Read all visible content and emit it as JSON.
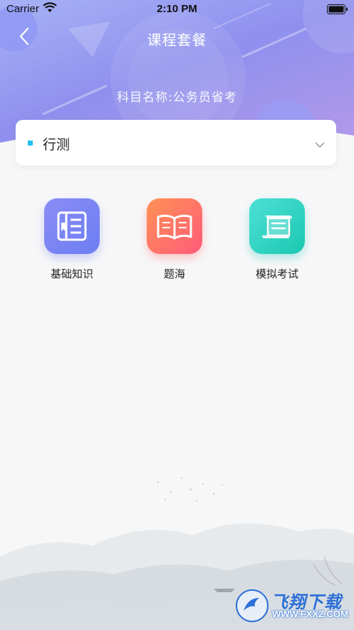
{
  "status_bar": {
    "carrier": "Carrier",
    "time": "2:10 PM"
  },
  "header": {
    "title": "课程套餐",
    "subject_line": "科目名称:公务员省考"
  },
  "selector": {
    "value": "行测",
    "accent_color": "#20bff0"
  },
  "categories": [
    {
      "label": "基础知识",
      "icon": "book-list-icon"
    },
    {
      "label": "题海",
      "icon": "open-book-icon"
    },
    {
      "label": "模拟考试",
      "icon": "scroll-icon"
    }
  ],
  "watermark": {
    "text": "飞翔下载",
    "url": "WWW.FXXZ.COM"
  }
}
